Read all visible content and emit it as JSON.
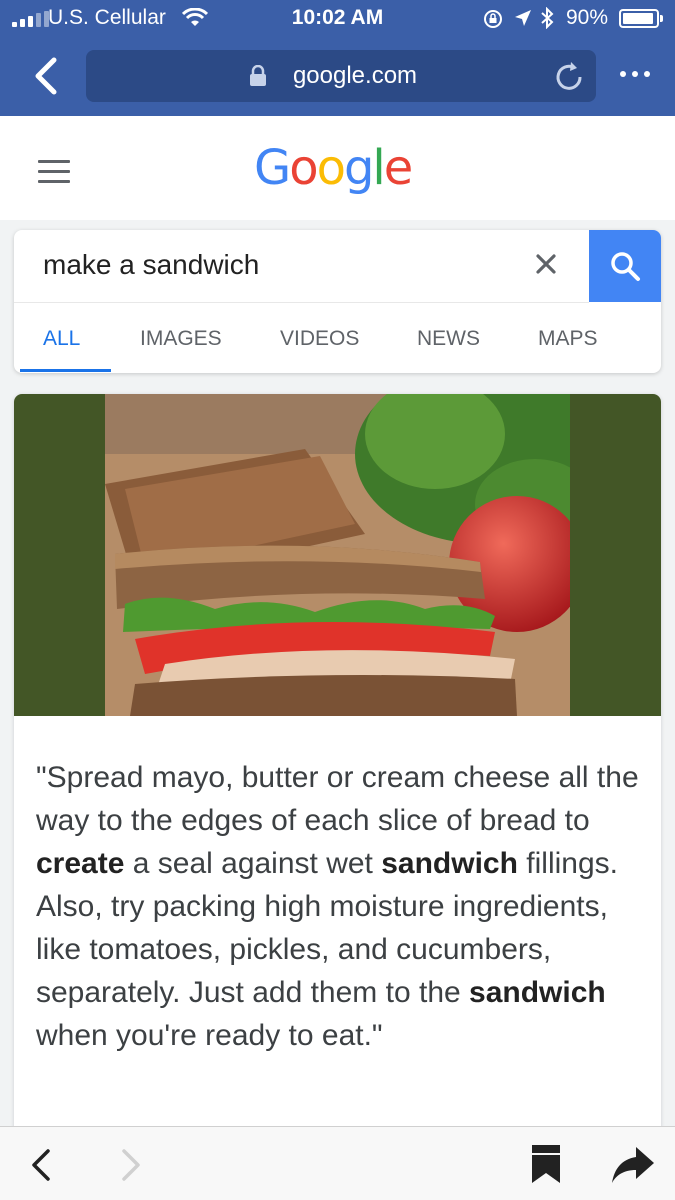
{
  "status_bar": {
    "carrier": "U.S. Cellular",
    "time": "10:02 AM",
    "battery_percent": "90%",
    "battery_level": 0.9
  },
  "browser": {
    "url": "google.com"
  },
  "google": {
    "logo_letters": [
      {
        "char": "G",
        "color": "#4285f4"
      },
      {
        "char": "o",
        "color": "#ea4335"
      },
      {
        "char": "o",
        "color": "#fbbc05"
      },
      {
        "char": "g",
        "color": "#4285f4"
      },
      {
        "char": "l",
        "color": "#34a853"
      },
      {
        "char": "e",
        "color": "#ea4335"
      }
    ]
  },
  "search": {
    "query": "make a sandwich"
  },
  "tabs": [
    {
      "label": "ALL",
      "active": true
    },
    {
      "label": "IMAGES",
      "active": false
    },
    {
      "label": "VIDEOS",
      "active": false
    },
    {
      "label": "NEWS",
      "active": false
    },
    {
      "label": "MAPS",
      "active": false
    }
  ],
  "snippet": {
    "image_icon": "sandwich-photo",
    "text_parts": [
      {
        "text": "\"Spread mayo, butter or cream cheese all the way to the edges of each slice of bread to ",
        "bold": false
      },
      {
        "text": "create",
        "bold": true
      },
      {
        "text": " a seal against wet ",
        "bold": false
      },
      {
        "text": "sandwich",
        "bold": true
      },
      {
        "text": " fillings. Also, try packing high moisture ingredients, like tomatoes, pickles, and cucumbers, separately. Just add them to the ",
        "bold": false
      },
      {
        "text": "sandwich",
        "bold": true
      },
      {
        "text": " when you're ready to eat.\"",
        "bold": false
      }
    ]
  },
  "colors": {
    "browser_bar": "#3b5fa8",
    "search_button": "#4285f4",
    "active_tab": "#1a73e8",
    "photo_background": "#435626"
  }
}
